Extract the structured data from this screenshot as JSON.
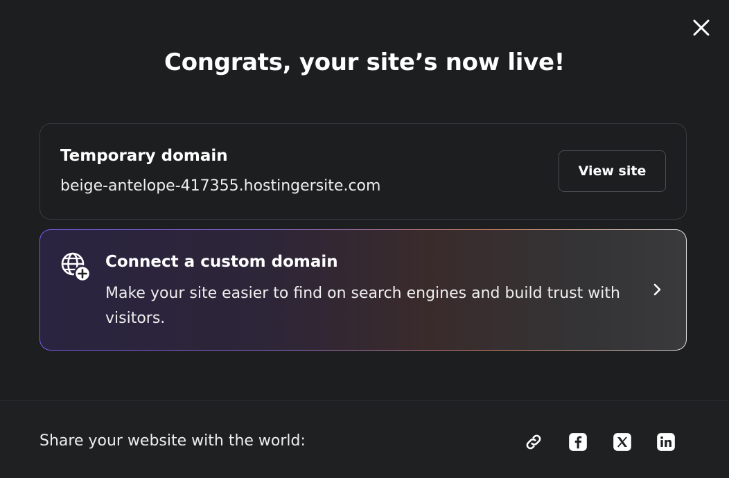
{
  "header": {
    "title": "Congrats, your site’s now live!",
    "close_icon": "close-icon"
  },
  "temporary_domain": {
    "label": "Temporary domain",
    "domain": "beige-antelope-417355.hostingersite.com",
    "view_button_label": "View site"
  },
  "custom_domain": {
    "icon": "globe-plus-icon",
    "title": "Connect a custom domain",
    "description": "Make your site easier to find on search engines and build trust with visitors.",
    "chevron_icon": "chevron-right-icon"
  },
  "footer": {
    "share_text": "Share your website with the world:",
    "social_icons": [
      "link-icon",
      "facebook-icon",
      "x-icon",
      "linkedin-icon"
    ]
  },
  "colors": {
    "background": "#1d1e20",
    "border": "#3a3b3f",
    "accent_purple": "#7c5cf0",
    "text": "#ffffff"
  }
}
